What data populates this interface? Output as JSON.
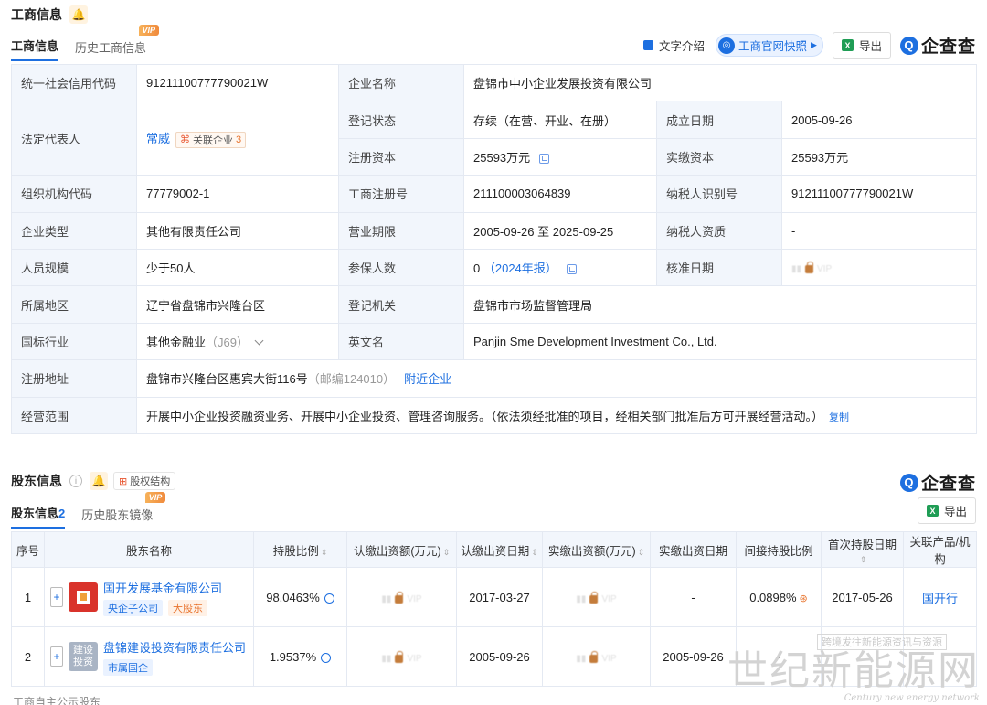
{
  "business_info": {
    "title": "工商信息",
    "tabs": [
      "工商信息",
      "历史工商信息"
    ],
    "vip": "VIP",
    "tools": {
      "text_intro": "文字介绍",
      "site_snapshot": "工商官网快照",
      "export": "导出",
      "xls": "X",
      "logo": "企查查",
      "logo_mark": "Q"
    },
    "rows": {
      "credit_code_label": "统一社会信用代码",
      "credit_code": "91211100777790021W",
      "company_name_label": "企业名称",
      "company_name": "盘锦市中小企业发展投资有限公司",
      "legal_rep_label": "法定代表人",
      "legal_rep": "常威",
      "related_label": "关联企业",
      "related_count": "3",
      "reg_status_label": "登记状态",
      "reg_status": "存续（在营、开业、在册）",
      "founded_label": "成立日期",
      "founded": "2005-09-26",
      "reg_capital_label": "注册资本",
      "reg_capital": "25593万元",
      "paid_capital_label": "实缴资本",
      "paid_capital": "25593万元",
      "org_code_label": "组织机构代码",
      "org_code": "77779002-1",
      "reg_no_label": "工商注册号",
      "reg_no": "211100003064839",
      "taxpayer_id_label": "纳税人识别号",
      "taxpayer_id": "91211100777790021W",
      "type_label": "企业类型",
      "type": "其他有限责任公司",
      "term_label": "营业期限",
      "term": "2005-09-26 至 2025-09-25",
      "tax_qual_label": "纳税人资质",
      "tax_qual": "-",
      "staff_label": "人员规模",
      "staff": "少于50人",
      "insured_label": "参保人数",
      "insured": "0",
      "insured_report": "（2024年报）",
      "approve_label": "核准日期",
      "approve_blur": "VIP",
      "region_label": "所属地区",
      "region": "辽宁省盘锦市兴隆台区",
      "authority_label": "登记机关",
      "authority": "盘锦市市场监督管理局",
      "industry_label": "国标行业",
      "industry": "其他金融业",
      "industry_code": "（J69）",
      "en_name_label": "英文名",
      "en_name": "Panjin Sme Development Investment Co., Ltd.",
      "address_label": "注册地址",
      "address": "盘锦市兴隆台区惠宾大街116号",
      "postcode": "（邮编124010）",
      "nearby": "附近企业",
      "scope_label": "经营范围",
      "scope": "开展中小企业投资融资业务、开展中小企业投资、管理咨询服务。（依法须经批准的项目，经相关部门批准后方可开展经营活动。）",
      "copy": "复制"
    }
  },
  "shareholders": {
    "title": "股东信息",
    "equity_chip": "股权结构",
    "tabs": [
      "股东信息",
      "历史股东镜像"
    ],
    "count": "2",
    "vip": "VIP",
    "export": "导出",
    "xls": "X",
    "logo": "企查查",
    "logo_mark": "Q",
    "columns": [
      "序号",
      "股东名称",
      "持股比例",
      "认缴出资额(万元)",
      "认缴出资日期",
      "实缴出资额(万元)",
      "实缴出资日期",
      "间接持股比例",
      "首次持股日期",
      "关联产品/机构"
    ],
    "sort_mark": "⇕",
    "rows": [
      {
        "idx": "1",
        "name": "国开发展基金有限公司",
        "tags": [
          "央企子公司",
          "大股东"
        ],
        "pct": "98.0463%",
        "sub_amt": "VIP",
        "sub_date": "2017-03-27",
        "paid_amt": "VIP",
        "paid_date": "-",
        "indirect": "0.0898%",
        "first_date": "2017-05-26",
        "related": "国开行"
      },
      {
        "idx": "2",
        "name": "盘锦建设投资有限责任公司",
        "tags": [
          "市属国企"
        ],
        "avatar_text": "建设投资",
        "pct": "1.9537%",
        "sub_amt": "VIP",
        "sub_date": "2005-09-26",
        "paid_amt": "VIP",
        "paid_date": "2005-09-26",
        "indirect": "-",
        "first_date": "",
        "related": ""
      }
    ]
  },
  "watermark": {
    "top": "跨境发往新能源资讯与资源",
    "big": "世纪新能源网",
    "sub": "Century new energy network"
  },
  "bottom_cut": "工商自主公示股东"
}
